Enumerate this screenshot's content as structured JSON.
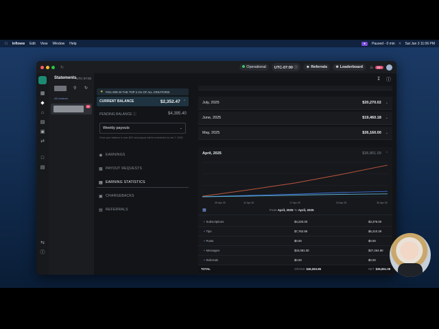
{
  "menubar": {
    "app_name": "Infloww",
    "items": [
      "Edit",
      "View",
      "Window",
      "Help"
    ],
    "right": {
      "recording": "Paused - 0 min",
      "clock": "Sat Jan 3  11:06 PM"
    }
  },
  "titlebar": {
    "status": "Operational",
    "timezone": "UTC-07:00",
    "referrals": "Referrals",
    "leaderboard": "Leaderboard",
    "msg_count": "99+"
  },
  "listpane": {
    "account_title": "Statements",
    "account_tz": "UTC-07:00",
    "section_label": "All creators",
    "item_badge": "3+"
  },
  "header": {
    "title": "STATEMENTS"
  },
  "sidebar": {
    "banner": "YOU ARE IN THE TOP 2.1% OF ALL CREATORS!",
    "current_balance_label": "CURRENT BALANCE",
    "current_balance": "$2,352.47",
    "pending_label": "PENDING BALANCE",
    "pending_balance": "$4,395.40",
    "payout_select": "Weekly payouts",
    "note": "Once your balance is over $20 next payout will be scheduled on Jan 7, 2026",
    "menu": [
      {
        "label": "EARNINGS",
        "icon": "dollar-icon"
      },
      {
        "label": "PAYOUT REQUESTS",
        "icon": "bank-icon"
      },
      {
        "label": "EARNING STATISTICS",
        "icon": "stats-icon"
      },
      {
        "label": "CHARGEBACKS",
        "icon": "refund-icon"
      },
      {
        "label": "REFERRALS",
        "icon": "people-icon"
      }
    ]
  },
  "months": [
    {
      "month": "July, 2025",
      "value": "$20,270.02"
    },
    {
      "month": "June, 2025",
      "value": "$19,460.18"
    },
    {
      "month": "May, 2025",
      "value": "$26,160.00"
    }
  ],
  "expanded": {
    "month": "April, 2025",
    "value": "$36,851.09",
    "range_from_label": "From",
    "range_from": "April, 2025",
    "range_to_label": "To",
    "range_to": "April, 2025",
    "rows": [
      {
        "name": "Subscriptions",
        "gross": "$4,220.00",
        "net": "$3,376.00"
      },
      {
        "name": "Tips",
        "gross": "$7,762.86",
        "net": "$6,210.29"
      },
      {
        "name": "Posts",
        "gross": "$0.00",
        "net": "$0.00"
      },
      {
        "name": "Messages",
        "gross": "$34,081.00",
        "net": "$27,264.80"
      },
      {
        "name": "Referrals",
        "gross": "$0.00",
        "net": "$0.00"
      }
    ],
    "total": {
      "label": "TOTAL",
      "gross_label": "GROSS",
      "gross": "$46,063.86",
      "net_label": "NET",
      "net": "$36,851.09"
    }
  },
  "chart_data": {
    "type": "line",
    "x": [
      "05 Apr 25",
      "11 Apr 25",
      "17 Apr 25",
      "23 Apr 25",
      "30 Apr 25"
    ],
    "series": [
      {
        "values": [
          500,
          8000,
          16000,
          26000,
          36851
        ]
      },
      {
        "values": [
          0,
          1500,
          3000,
          5000,
          6210
        ]
      },
      {
        "values": [
          0,
          800,
          1800,
          2800,
          3376
        ]
      }
    ],
    "colors": [
      "#c0573c",
      "#3b6fd6",
      "#5fb7d6"
    ],
    "ylim": [
      0,
      40000
    ],
    "grid": true
  }
}
